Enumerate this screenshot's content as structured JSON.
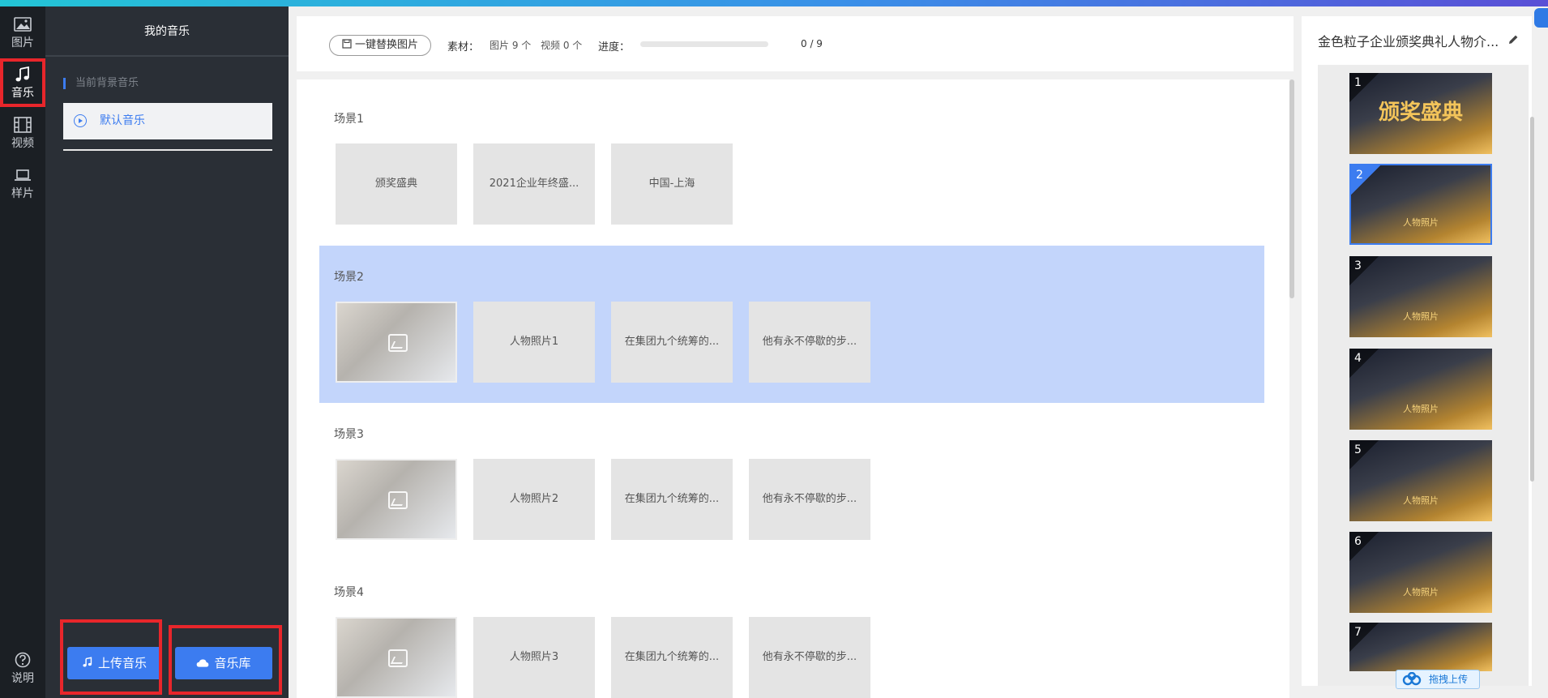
{
  "nav": {
    "items": [
      {
        "label": "图片",
        "icon": "image-icon"
      },
      {
        "label": "音乐",
        "icon": "music-icon"
      },
      {
        "label": "视频",
        "icon": "film-icon"
      },
      {
        "label": "样片",
        "icon": "laptop-icon"
      }
    ],
    "help_label": "说明"
  },
  "music_panel": {
    "title": "我的音乐",
    "section_label": "当前背景音乐",
    "current_track": "默认音乐",
    "upload_label": "上传音乐",
    "library_label": "音乐库"
  },
  "toolbar": {
    "replace_label": "一键替换图片",
    "material_label": "素材：",
    "image_count": "图片 9 个",
    "video_count": "视频 0 个",
    "progress_label": "进度：",
    "progress_text": "0 / 9",
    "progress_value": 0
  },
  "scenes": [
    {
      "title": "场景1",
      "tiles": [
        "颁奖盛典",
        "2021企业年终盛...",
        "中国-上海"
      ]
    },
    {
      "title": "场景2",
      "tiles": [
        "人物照片1",
        "在集团九个统筹的...",
        "他有永不停歇的步..."
      ]
    },
    {
      "title": "场景3",
      "tiles": [
        "人物照片2",
        "在集团九个统筹的...",
        "他有永不停歇的步..."
      ]
    },
    {
      "title": "场景4",
      "tiles": [
        "人物照片3",
        "在集团九个统筹的...",
        "他有永不停歇的步..."
      ]
    }
  ],
  "preview": {
    "title": "金色粒子企业颁奖典礼人物介...",
    "thumbs": [
      "1",
      "2",
      "3",
      "4",
      "5",
      "6",
      "7"
    ],
    "thumb1_headline": "颁奖盛典",
    "thumb_caption": "人物照片",
    "drag_upload_label": "拖拽上传"
  },
  "colors": {
    "accent": "#3c7cf0",
    "highlight_border": "#e8262b",
    "selected_scene_bg": "#c3d5fb",
    "sidebar_bg": "#1b1f24",
    "panel_bg": "#2a2f36"
  }
}
